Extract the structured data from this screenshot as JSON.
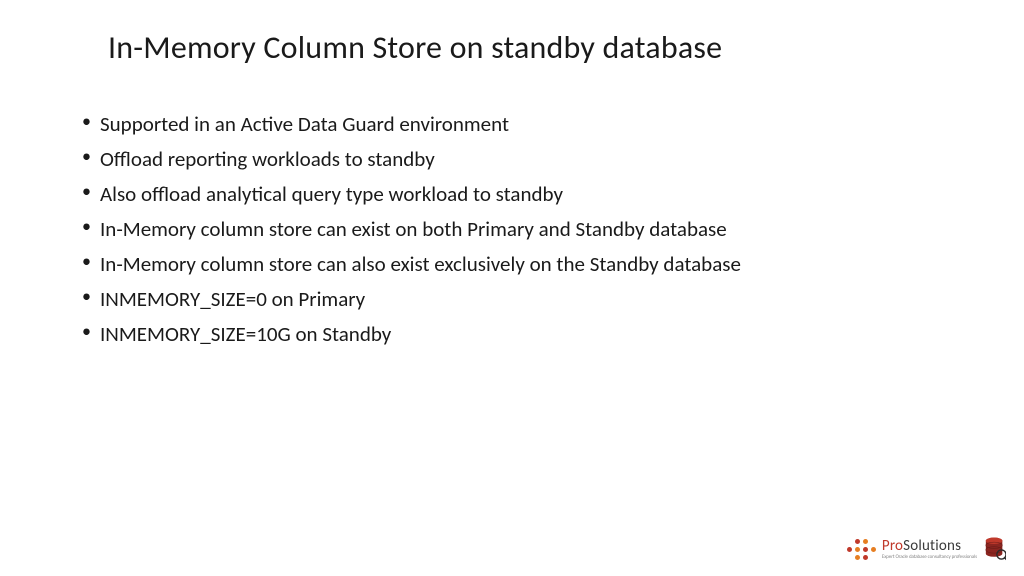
{
  "title": "In-Memory Column Store on standby database",
  "bullets": [
    "Supported in an Active Data Guard environment",
    "Offload reporting workloads to standby",
    "Also offload analytical query type workload to standby",
    "In-Memory column store can exist on both Primary and Standby database",
    "In-Memory column store can also exist exclusively on the Standby database",
    "INMEMORY_SIZE=0 on Primary",
    "INMEMORY_SIZE=10G on Standby"
  ],
  "logo": {
    "brand_prefix": "Pro",
    "brand_suffix": "Solutions",
    "tagline": "Expert Oracle database consultancy professionals"
  }
}
